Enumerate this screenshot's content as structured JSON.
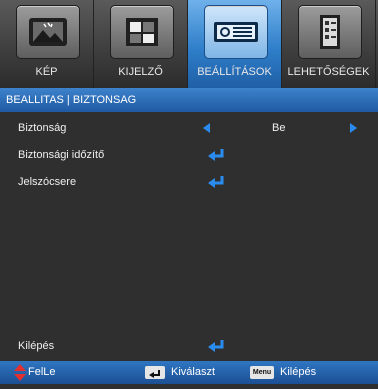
{
  "tabs": [
    {
      "label": "KÉP",
      "icon": "picture-icon",
      "active": false
    },
    {
      "label": "KIJELZŐ",
      "icon": "display-icon",
      "active": false
    },
    {
      "label": "BEÁLLÍTÁSOK",
      "icon": "projector-icon",
      "active": true
    },
    {
      "label": "LEHETŐSÉGEK",
      "icon": "options-icon",
      "active": false
    }
  ],
  "breadcrumb": "BEALLITAS | BIZTONSAG",
  "menu": {
    "security": {
      "label": "Biztonság",
      "value": "Be"
    },
    "security_timer": {
      "label": "Biztonsági időzítő"
    },
    "password_change": {
      "label": "Jelszócsere"
    },
    "exit": {
      "label": "Kilépés"
    }
  },
  "footer": {
    "updown": "FelLe",
    "select": "Kiválaszt",
    "menu_key": "Menu",
    "exit": "Kilépés"
  },
  "colors": {
    "accent": "#2b8cf0",
    "bar": "#1f5aa3"
  }
}
